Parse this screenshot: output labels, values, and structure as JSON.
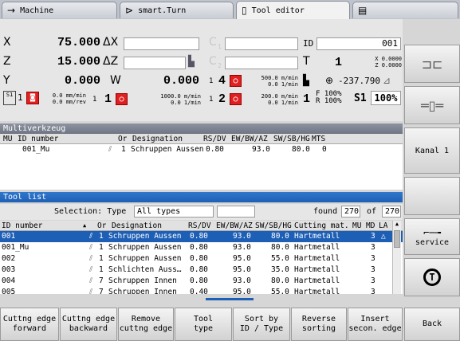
{
  "tabs": [
    {
      "label": "Machine",
      "icon": "→"
    },
    {
      "label": "smart.Turn",
      "icon": "⊳"
    },
    {
      "label": "Tool editor",
      "icon": "▯"
    },
    {
      "label": "",
      "icon": "▤"
    }
  ],
  "status": {
    "x_label": "X",
    "x_value": "75.000",
    "x_delta": "ΔX",
    "z_label": "Z",
    "z_value": "15.000",
    "z_delta": "ΔZ",
    "y_label": "Y",
    "y_value": "0.000",
    "w_label": "W",
    "w_value": "0.000",
    "c1_label": "C",
    "c1_sub": "1",
    "c2_label": "C",
    "c2_sub": "2",
    "id_label": "ID",
    "id_value": "001",
    "t_label": "T",
    "t_value": "1",
    "t_x": "X  0.0000",
    "t_z": "Z  0.0000",
    "spindle4": "4",
    "spindle4_speed": "500.0 m/min",
    "spindle4_rpm": "0.0 1/min",
    "angle_value": "-237.790",
    "feed_top": "0.0 mm/min",
    "feed_bot": "0.0 mm/rev",
    "s1_label": "1",
    "s1_speed": "1000.0 m/min",
    "s1_rpm": "0.0 1/min",
    "s2_label": "2",
    "s2_speed": "200.0 m/min",
    "s2_rpm": "0.0 1/min",
    "f_label": "F 100%",
    "r_label": "R 100%",
    "s1pct_label": "S1",
    "s1pct_value": "100%",
    "channel_num": "1",
    "s1_tag": "S1",
    "circle1": "1",
    "circle2": "1",
    "circle3": "1"
  },
  "multi": {
    "title": "Multiverkzeug",
    "headers": [
      "MU",
      "ID number",
      "Or",
      "Designation",
      "RS/DV",
      "EW/BW/AZ",
      "SW/SB/HG",
      "MTS"
    ],
    "rows": [
      {
        "mu": "",
        "id": "001_Mu",
        "or": "1",
        "desig": "Schruppen Aussen",
        "rs": "0.80",
        "ew": "93.0",
        "sw": "80.0",
        "mts": "0"
      }
    ]
  },
  "toollist": {
    "title": "Tool list",
    "selection_label": "Selection: Type",
    "selection_value": "All types",
    "found_label": "found",
    "found_value": "270",
    "of_label": "of",
    "of_value": "270",
    "headers": [
      "ID number",
      "Or",
      "Designation",
      "RS/DV",
      "EW/BW/AZ",
      "SW/SB/HG",
      "Cutting mat.",
      "MU",
      "MD",
      "LA"
    ],
    "rows": [
      {
        "id": "001",
        "or": "1",
        "desig": "Schruppen Aussen",
        "rs": "0.80",
        "ew": "93.0",
        "sw": "80.0",
        "mat": "Hartmetall",
        "mu": "",
        "md": "3",
        "la": "△",
        "sel": true
      },
      {
        "id": "001_Mu",
        "or": "1",
        "desig": "Schruppen Aussen",
        "rs": "0.80",
        "ew": "93.0",
        "sw": "80.0",
        "mat": "Hartmetall",
        "mu": "",
        "md": "3",
        "la": ""
      },
      {
        "id": "002",
        "or": "1",
        "desig": "Schruppen Aussen",
        "rs": "0.80",
        "ew": "95.0",
        "sw": "55.0",
        "mat": "Hartmetall",
        "mu": "",
        "md": "3",
        "la": ""
      },
      {
        "id": "003",
        "or": "1",
        "desig": "Schlichten Auss…",
        "rs": "0.80",
        "ew": "95.0",
        "sw": "35.0",
        "mat": "Hartmetall",
        "mu": "",
        "md": "3",
        "la": ""
      },
      {
        "id": "004",
        "or": "7",
        "desig": "Schruppen Innen",
        "rs": "0.80",
        "ew": "93.0",
        "sw": "80.0",
        "mat": "Hartmetall",
        "mu": "",
        "md": "3",
        "la": ""
      },
      {
        "id": "005",
        "or": "7",
        "desig": "Schruppen Innen",
        "rs": "0.40",
        "ew": "95.0",
        "sw": "55.0",
        "mat": "Hartmetall",
        "mu": "",
        "md": "3",
        "la": ""
      }
    ]
  },
  "right_softkeys": [
    "",
    "",
    "Kanal 1",
    "",
    "service",
    ""
  ],
  "bottom_softkeys": [
    "Cuttng edge\nforward",
    "Cuttng edge\nbackward",
    "Remove\ncuttng edge",
    "Tool\ntype",
    "Sort by\nID / Type",
    "Reverse\nsorting",
    "Insert\nsecon. edge",
    "Back"
  ]
}
